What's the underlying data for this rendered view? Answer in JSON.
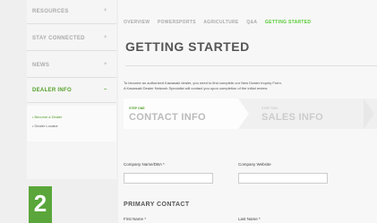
{
  "sidebar": {
    "items": [
      {
        "label": "RESOURCES",
        "chevron": "+"
      },
      {
        "label": "STAY CONNECTED",
        "chevron": "+"
      },
      {
        "label": "NEWS",
        "chevron": "+"
      },
      {
        "label": "DEALER INFO",
        "chevron": "–"
      }
    ],
    "subitems": [
      {
        "label": "• Become a Dealer"
      },
      {
        "label": "• Dealer Locator"
      }
    ]
  },
  "topnav": {
    "items": [
      "OVERVIEW",
      "POWERSPORTS",
      "AGRICULTURE",
      "Q&A",
      "GETTING STARTED"
    ]
  },
  "main": {
    "title": "GETTING STARTED",
    "intro_line1": "To become an authorized Kawasaki dealer, you need to first complete our New Dealer Inquiry Form.",
    "intro_line2": "A Kawasaki Dealer Network Specialist will contact you upon completion of the initial review."
  },
  "steps": [
    {
      "num": "STEP ONE",
      "title": "CONTACT INFO"
    },
    {
      "num": "STEP TWO",
      "title": "SALES INFO"
    }
  ],
  "form": {
    "company_name_label": "Company Name/DBA *",
    "company_website_label": "Company Website",
    "section_title": "PRIMARY CONTACT",
    "first_name_label": "First Name *",
    "last_name_label": "Last Name *"
  },
  "badge": {
    "number": "2"
  },
  "colors": {
    "accent": "#55a02a",
    "badge": "#5aa63a"
  }
}
